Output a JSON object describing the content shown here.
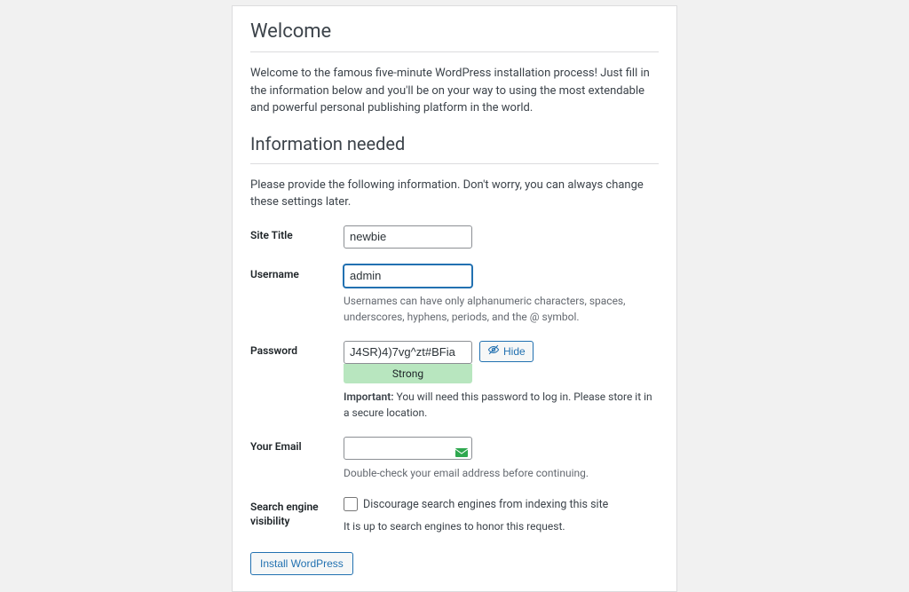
{
  "welcome": {
    "heading": "Welcome",
    "intro": "Welcome to the famous five-minute WordPress installation process! Just fill in the information below and you'll be on your way to using the most extendable and powerful personal publishing platform in the world."
  },
  "info": {
    "heading": "Information needed",
    "intro": "Please provide the following information. Don't worry, you can always change these settings later."
  },
  "fields": {
    "site_title": {
      "label": "Site Title",
      "value": "newbie"
    },
    "username": {
      "label": "Username",
      "value": "admin",
      "hint": "Usernames can have only alphanumeric characters, spaces, underscores, hyphens, periods, and the @ symbol."
    },
    "password": {
      "label": "Password",
      "value": "J4SR)4)7vg^zt#BFia",
      "strength": "Strong",
      "hide_button": "Hide",
      "important_label": "Important:",
      "important_text": " You will need this password to log in. Please store it in a secure location."
    },
    "email": {
      "label": "Your Email",
      "value": "",
      "hint": "Double-check your email address before continuing."
    },
    "sev": {
      "label": "Search engine visibility",
      "checkbox_label": "Discourage search engines from indexing this site",
      "note": "It is up to search engines to honor this request."
    }
  },
  "submit": {
    "label": "Install WordPress"
  }
}
